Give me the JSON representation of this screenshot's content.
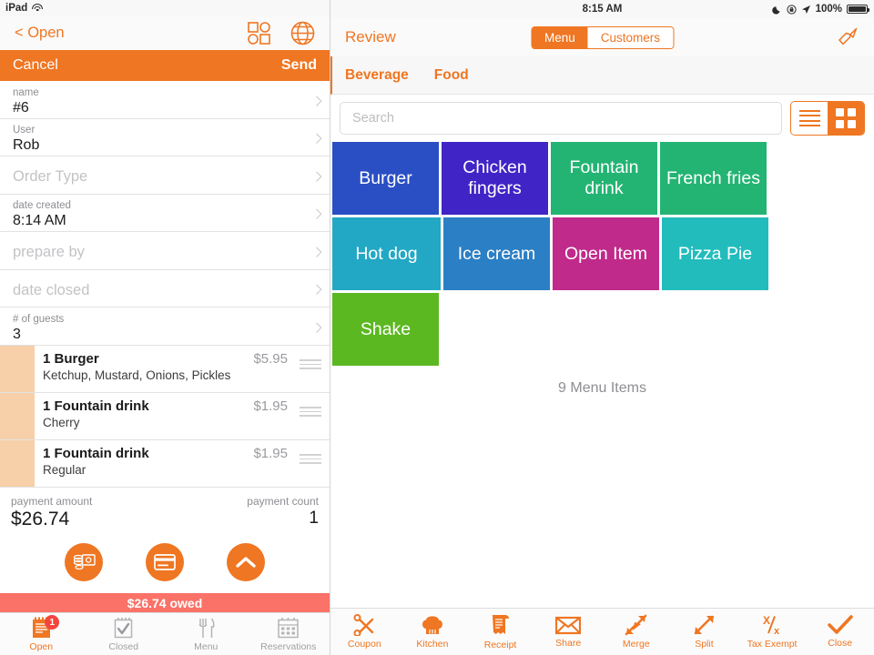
{
  "left": {
    "statusbar": {
      "device": "iPad",
      "wifi_icon": "wifi-icon"
    },
    "navbar": {
      "back_label": "< Open",
      "shapes_icon": "shapes-grid-icon",
      "globe_icon": "globe-icon"
    },
    "actionbar": {
      "cancel_label": "Cancel",
      "send_label": "Send"
    },
    "form_fields": [
      {
        "label": "name",
        "value": "#6",
        "placeholder": ""
      },
      {
        "label": "User",
        "value": "Rob",
        "placeholder": ""
      },
      {
        "label": "",
        "value": "",
        "placeholder": "Order Type"
      },
      {
        "label": "date created",
        "value": "8:14 AM",
        "placeholder": ""
      },
      {
        "label": "",
        "value": "",
        "placeholder": "prepare by"
      },
      {
        "label": "",
        "value": "",
        "placeholder": "date closed"
      },
      {
        "label": "# of guests",
        "value": "3",
        "placeholder": ""
      }
    ],
    "order_items": [
      {
        "name": "1 Burger",
        "price": "$5.95",
        "modifiers": "Ketchup, Mustard, Onions, Pickles"
      },
      {
        "name": "1 Fountain drink",
        "price": "$1.95",
        "modifiers": "Cherry"
      },
      {
        "name": "1 Fountain drink",
        "price": "$1.95",
        "modifiers": "Regular"
      }
    ],
    "payment": {
      "amount_label": "payment amount",
      "amount_value": "$26.74",
      "count_label": "payment count",
      "count_value": "1",
      "cash_icon": "cash-money-icon",
      "card_icon": "credit-card-icon",
      "expand_icon": "chevron-up-icon"
    },
    "owed_bar": {
      "text": "$26.74 owed",
      "color": "#fa7268"
    },
    "tabs": [
      {
        "label": "Open",
        "icon": "notepad-icon",
        "badge": "1",
        "active": true
      },
      {
        "label": "Closed",
        "icon": "checklist-icon",
        "badge": "",
        "active": false
      },
      {
        "label": "Menu",
        "icon": "fork-knife-icon",
        "badge": "",
        "active": false
      },
      {
        "label": "Reservations",
        "icon": "calendar-icon",
        "badge": "",
        "active": false
      }
    ]
  },
  "right": {
    "statusbar": {
      "time": "8:15 AM",
      "moon_icon": "moon-icon",
      "rotation_lock_icon": "rotation-lock-icon",
      "location_icon": "location-arrow-icon",
      "battery_pct": "100%",
      "battery_icon": "battery-icon"
    },
    "navbar": {
      "title": "Review",
      "segment_menu": "Menu",
      "segment_customers": "Customers",
      "brush_icon": "paintbrush-icon"
    },
    "category_tabs": [
      {
        "label": "Beverage"
      },
      {
        "label": "Food"
      }
    ],
    "search": {
      "placeholder": "Search",
      "value": ""
    },
    "view_toggle": {
      "list_icon": "list-view-icon",
      "grid_icon": "grid-view-icon",
      "active": "grid"
    },
    "menu_tiles": [
      {
        "label": "Burger",
        "color": "#2a4fc4"
      },
      {
        "label": "Chicken fingers",
        "color": "#4024c6"
      },
      {
        "label": "Fountain drink",
        "color": "#23b473"
      },
      {
        "label": "French fries",
        "color": "#23b473"
      },
      {
        "label": "Hot dog",
        "color": "#22a8c4"
      },
      {
        "label": "Ice cream",
        "color": "#2b7fc4"
      },
      {
        "label": "Open Item",
        "color": "#c02a8a"
      },
      {
        "label": "Pizza Pie",
        "color": "#22bcbc"
      },
      {
        "label": "Shake",
        "color": "#5cb821"
      }
    ],
    "item_count": "9 Menu Items",
    "toolbar": [
      {
        "label": "Coupon",
        "icon": "scissors-icon"
      },
      {
        "label": "Kitchen",
        "icon": "chef-hat-icon"
      },
      {
        "label": "Receipt",
        "icon": "receipt-icon"
      },
      {
        "label": "Share",
        "icon": "envelope-icon"
      },
      {
        "label": "Merge",
        "icon": "merge-arrows-icon"
      },
      {
        "label": "Split",
        "icon": "split-arrows-icon"
      },
      {
        "label": "Tax Exempt",
        "icon": "tax-exempt-icon"
      },
      {
        "label": "Close",
        "icon": "checkmark-icon"
      }
    ]
  },
  "colors": {
    "accent": "#ef7622",
    "badge": "#f2453d",
    "owed": "#fa7268"
  }
}
